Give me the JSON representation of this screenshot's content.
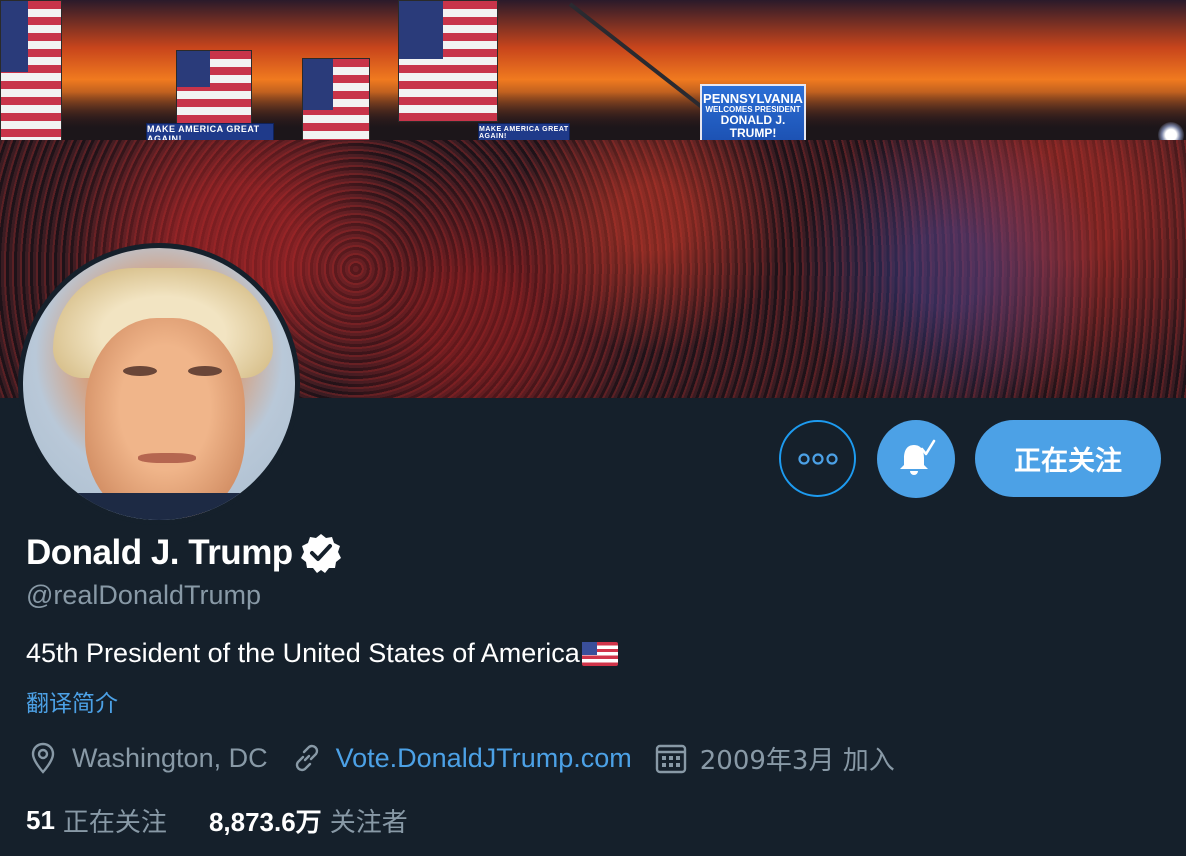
{
  "banner": {
    "signs": [
      "MAKE AMERICA GREAT AGAIN!",
      "MAKE AMERICA GREAT AGAIN!"
    ],
    "screen": [
      "PENNSYLVANIA",
      "WELCOMES PRESIDENT",
      "DONALD J. TRUMP!"
    ]
  },
  "profile": {
    "name": "Donald J. Trump",
    "handle": "@realDonaldTrump",
    "bio": "45th President of the United States of America",
    "translate_label": "翻译简介",
    "location": "Washington, DC",
    "website": "Vote.DonaldJTrump.com",
    "joined": "2009年3月 加入",
    "following_count": "51",
    "following_label": "正在关注",
    "followers_count": "8,873.6万",
    "followers_label": "关注者"
  },
  "actions": {
    "more_label": "ooo",
    "follow_label": "正在关注"
  },
  "colors": {
    "background": "#15202b",
    "accent": "#4ca1e6",
    "secondary_text": "#8899a6"
  },
  "icons": {
    "verified": "verified-badge-icon",
    "location": "location-pin-icon",
    "link": "link-icon",
    "calendar": "calendar-icon",
    "bell": "bell-notification-icon"
  }
}
